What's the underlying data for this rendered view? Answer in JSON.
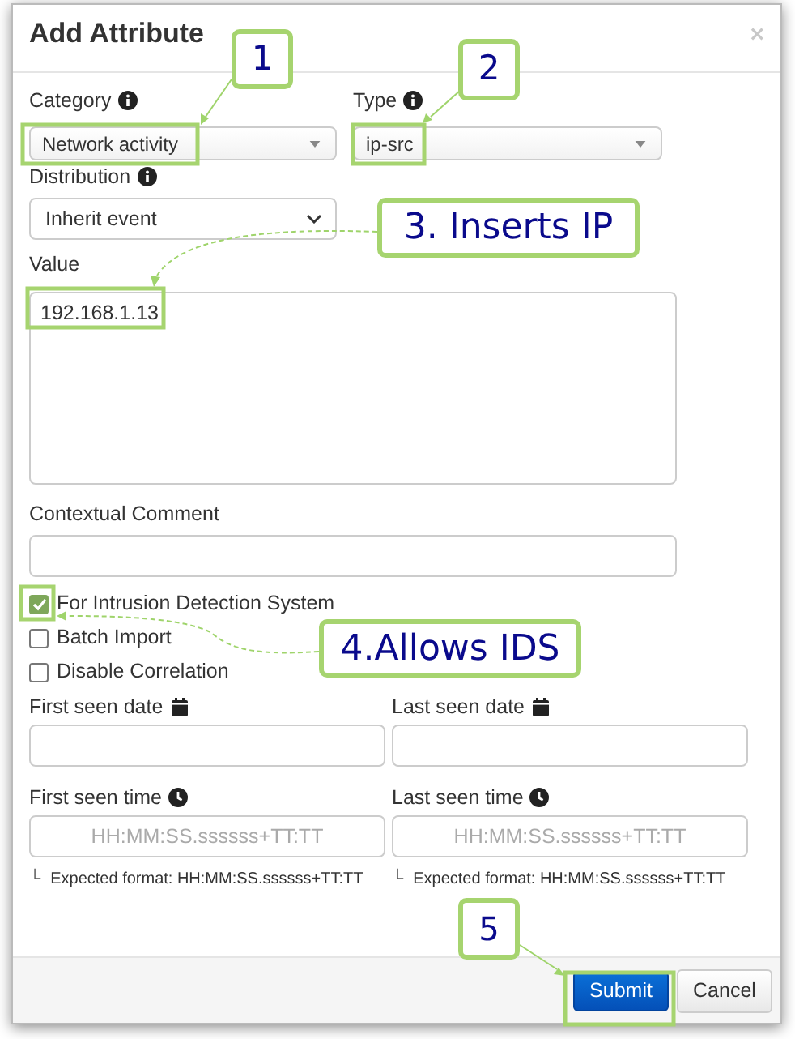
{
  "dialog": {
    "title": "Add Attribute",
    "close": "×"
  },
  "selects": [
    {
      "label": "Category",
      "value": "Network activity",
      "kind": "triangle"
    },
    {
      "label": "Type",
      "value": "ip-src",
      "kind": "triangle"
    },
    {
      "label": "Distribution",
      "value": "Inherit event",
      "kind": "chevron"
    }
  ],
  "value_field": {
    "label": "Value",
    "value": "192.168.1.13"
  },
  "comment_field": {
    "label": "Contextual Comment"
  },
  "checkboxes": [
    {
      "label": "For Intrusion Detection System",
      "checked": true
    },
    {
      "label": "Batch Import",
      "checked": false
    },
    {
      "label": "Disable Correlation",
      "checked": false
    }
  ],
  "date_fields": [
    {
      "label": "First seen date"
    },
    {
      "label": "Last seen date"
    }
  ],
  "time_fields": [
    {
      "label": "First seen time",
      "placeholder": "HH:MM:SS.ssssss+TT:TT",
      "hint_mark": "└",
      "hint": "Expected format: HH:MM:SS.ssssss+TT:TT"
    },
    {
      "label": "Last seen time",
      "placeholder": "HH:MM:SS.ssssss+TT:TT",
      "hint_mark": "└",
      "hint": "Expected format: HH:MM:SS.ssssss+TT:TT"
    }
  ],
  "buttons": [
    {
      "label": "Submit",
      "kind": "primary"
    },
    {
      "label": "Cancel",
      "kind": "secondary"
    }
  ],
  "annotations": [
    {
      "text": "1"
    },
    {
      "text": "2"
    },
    {
      "text": "3. Inserts IP"
    },
    {
      "text": "4.Allows IDS"
    },
    {
      "text": "5"
    }
  ]
}
